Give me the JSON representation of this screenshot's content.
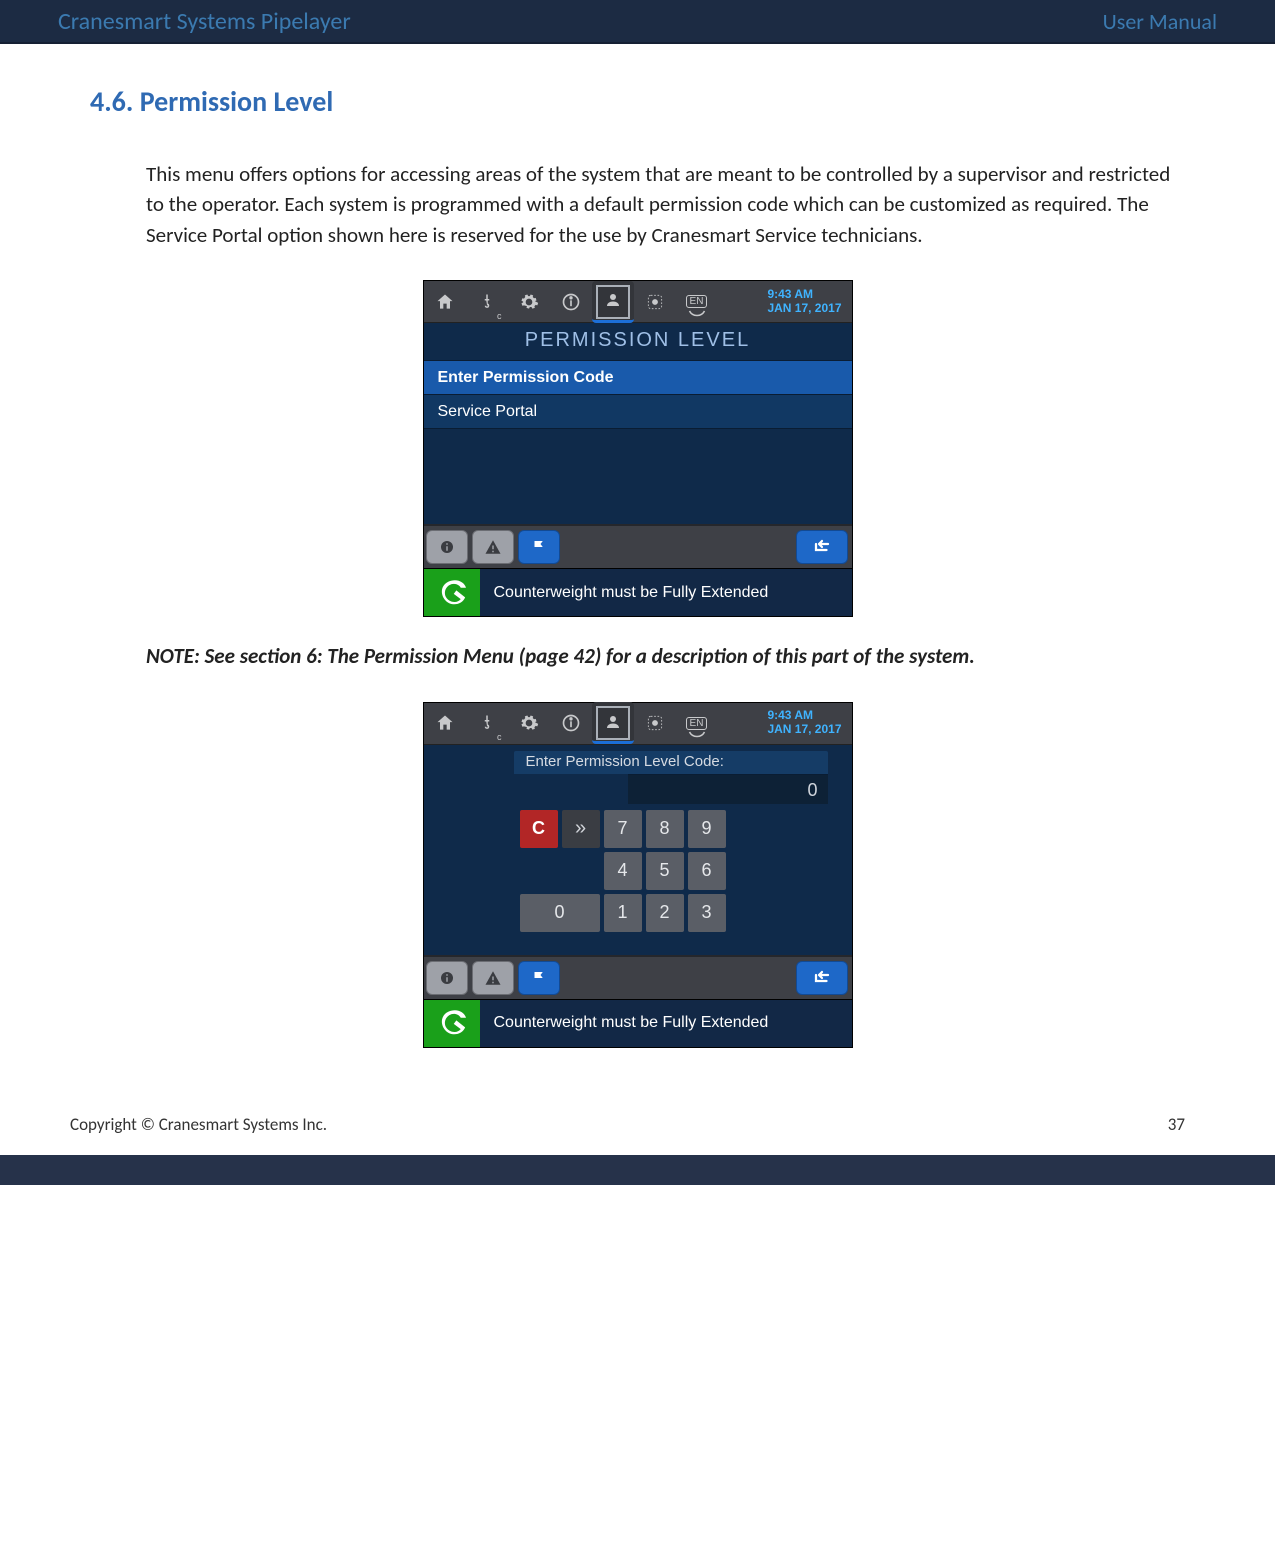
{
  "header": {
    "title_left": "Cranesmart Systems Pipelayer",
    "title_right": "User Manual"
  },
  "section": {
    "number": "4.6.",
    "title": "Permission Level",
    "body": "This menu offers options for accessing areas of the system that are meant to be controlled by a supervisor and restricted to the operator.  Each system is programmed with a default permission code which can be customized as required.  The Service Portal option shown here is reserved for the use by Cranesmart Service technicians.",
    "note": "NOTE: See section 6: The Permission Menu (page 42) for a description of this part of the system."
  },
  "device_common": {
    "time": "9:43 AM",
    "date": "JAN 17, 2017",
    "lang_badge": "EN",
    "status_message": "Counterweight must be Fully Extended"
  },
  "screen1": {
    "title": "PERMISSION LEVEL",
    "row_selected": "Enter Permission Code",
    "row_normal": "Service Portal"
  },
  "screen2": {
    "prompt": "Enter Permission Level Code:",
    "value": "0",
    "keypad": {
      "clear": "C",
      "next": "»",
      "k7": "7",
      "k8": "8",
      "k9": "9",
      "k4": "4",
      "k5": "5",
      "k6": "6",
      "k0": "0",
      "k1": "1",
      "k2": "2",
      "k3": "3"
    }
  },
  "footer": {
    "copyright": "Copyright © Cranesmart Systems Inc.",
    "page": "37"
  }
}
